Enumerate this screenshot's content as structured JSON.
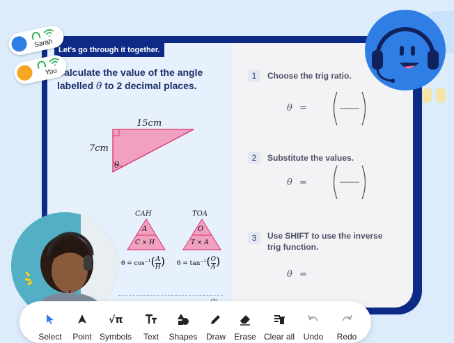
{
  "banner": "Let's go through it together.",
  "question": {
    "line1": "Calculate the value of the angle",
    "line2_prefix": "labelled",
    "theta": "θ",
    "line2_suffix": "to 2 decimal places."
  },
  "diagram": {
    "top_side": "15cm",
    "left_side": "7cm",
    "angle": "θ",
    "mark": "(3)"
  },
  "triangles": [
    {
      "title": "CAH",
      "top": "A",
      "bottom": "C × H",
      "formula_prefix": "θ = cos",
      "sup": "−1",
      "num": "A",
      "den": "H"
    },
    {
      "title": "TOA",
      "top": "O",
      "bottom": "T × A",
      "formula_prefix": "θ = tan",
      "sup": "−1",
      "num": "O",
      "den": "A"
    }
  ],
  "steps": [
    {
      "num": "1",
      "text": "Choose the trig ratio.",
      "lhs": "θ",
      "eq": "="
    },
    {
      "num": "2",
      "text": "Substitute the values.",
      "lhs": "θ",
      "eq": "="
    },
    {
      "num": "3",
      "line1": "Use SHIFT to use the inverse",
      "line2": "trig function.",
      "lhs": "θ",
      "eq": "="
    }
  ],
  "participants": [
    {
      "name": "Sarah",
      "color": "#2f7ee5"
    },
    {
      "name": "You",
      "color": "#f5a623"
    }
  ],
  "toolbar": [
    {
      "label": "Select",
      "icon": "cursor-icon"
    },
    {
      "label": "Point",
      "icon": "pointer-icon"
    },
    {
      "label": "Symbols",
      "icon": "sqrt-pi-icon"
    },
    {
      "label": "Text",
      "icon": "text-icon"
    },
    {
      "label": "Shapes",
      "icon": "shapes-icon"
    },
    {
      "label": "Draw",
      "icon": "pencil-icon"
    },
    {
      "label": "Erase",
      "icon": "eraser-icon"
    },
    {
      "label": "Clear all",
      "icon": "clear-all-icon"
    },
    {
      "label": "Undo",
      "icon": "undo-icon"
    },
    {
      "label": "Redo",
      "icon": "redo-icon"
    }
  ],
  "colors": {
    "navy": "#0c2a86",
    "pink": "#f2a0bf",
    "pink_stroke": "#d9336f",
    "accent": "#2f7ee5"
  }
}
